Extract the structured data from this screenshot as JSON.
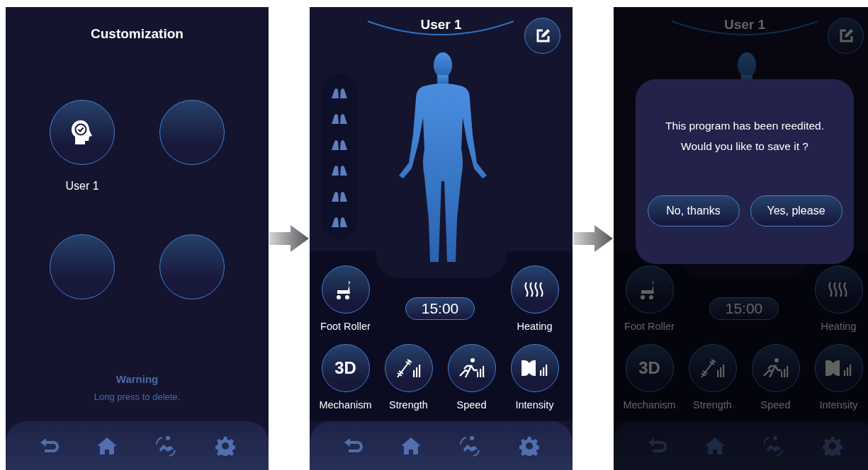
{
  "screens": [
    {
      "kind": "profiles",
      "title": "Customization",
      "profiles": [
        {
          "kind": "user",
          "label": "User 1"
        },
        {
          "kind": "empty"
        },
        {
          "kind": "empty"
        },
        {
          "kind": "empty"
        }
      ],
      "warning": {
        "title": "Warning",
        "text": "Long press to delete."
      }
    },
    {
      "kind": "program",
      "title": "User 1",
      "timer": "15:00",
      "controls": [
        {
          "kind": "roller",
          "label": "Foot Roller"
        },
        {
          "kind": "heat",
          "label": "Heating"
        },
        {
          "kind": "mechanism",
          "glyph": "3D",
          "label": "Mechanism"
        },
        {
          "kind": "strength",
          "label": "Strength"
        },
        {
          "kind": "speed",
          "label": "Speed"
        },
        {
          "kind": "intensity",
          "label": "Intensity"
        }
      ]
    },
    {
      "kind": "program",
      "title": "User 1",
      "timer": "15:00",
      "controls": [
        {
          "kind": "roller",
          "label": "Foot Roller"
        },
        {
          "kind": "heat",
          "label": "Heating"
        },
        {
          "kind": "mechanism",
          "glyph": "3D",
          "label": "Mechanism"
        },
        {
          "kind": "strength",
          "label": "Strength"
        },
        {
          "kind": "speed",
          "label": "Speed"
        },
        {
          "kind": "intensity",
          "label": "Intensity"
        }
      ],
      "dialog": {
        "lines": [
          "This program has been reedited.",
          "Would you like to save it ?"
        ],
        "buttons": [
          "No, thanks",
          "Yes, please"
        ]
      }
    }
  ]
}
